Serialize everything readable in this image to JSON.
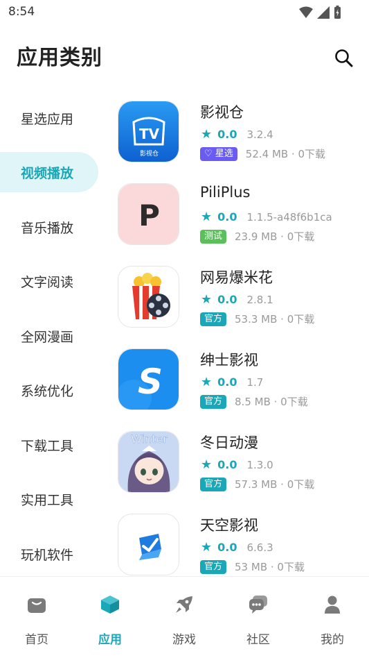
{
  "status_bar": {
    "time": "8:54"
  },
  "header": {
    "title": "应用类别"
  },
  "categories": [
    {
      "label": "星选应用",
      "active": false
    },
    {
      "label": "视频播放",
      "active": true
    },
    {
      "label": "音乐播放",
      "active": false
    },
    {
      "label": "文字阅读",
      "active": false
    },
    {
      "label": "全网漫画",
      "active": false
    },
    {
      "label": "系统优化",
      "active": false
    },
    {
      "label": "下载工具",
      "active": false
    },
    {
      "label": "实用工具",
      "active": false
    },
    {
      "label": "玩机软件",
      "active": false
    }
  ],
  "apps": [
    {
      "name": "影视仓",
      "star": "★",
      "rating": "0.0",
      "version": "3.2.4",
      "badge": "♡ 星选",
      "badge_type": "star",
      "size_downloads": "52.4 MB · 0下载",
      "icon_text": "TV",
      "icon_subtext": "影视仓"
    },
    {
      "name": "PiliPlus",
      "star": "★",
      "rating": "0.0",
      "version": "1.1.5-a48f6b1ca",
      "badge": "测试",
      "badge_type": "test",
      "size_downloads": "23.9 MB · 0下载",
      "icon_text": "P"
    },
    {
      "name": "网易爆米花",
      "star": "★",
      "rating": "0.0",
      "version": "2.8.1",
      "badge": "官方",
      "badge_type": "official",
      "size_downloads": "53.3 MB · 0下载"
    },
    {
      "name": "绅士影视",
      "star": "★",
      "rating": "0.0",
      "version": "1.7",
      "badge": "官方",
      "badge_type": "official",
      "size_downloads": "8.5 MB · 0下载",
      "icon_text": "S"
    },
    {
      "name": "冬日动漫",
      "star": "★",
      "rating": "0.0",
      "version": "1.3.0",
      "badge": "官方",
      "badge_type": "official",
      "size_downloads": "57.3 MB · 0下载",
      "icon_text": "Winter"
    },
    {
      "name": "天空影视",
      "star": "★",
      "rating": "0.0",
      "version": "6.6.3",
      "badge": "官方",
      "badge_type": "official",
      "size_downloads": "53 MB · 0下载"
    }
  ],
  "bottom_nav": [
    {
      "label": "首页",
      "icon": "bag-icon",
      "active": false
    },
    {
      "label": "应用",
      "icon": "cube-icon",
      "active": true
    },
    {
      "label": "游戏",
      "icon": "rocket-icon",
      "active": false
    },
    {
      "label": "社区",
      "icon": "chat-icon",
      "active": false
    },
    {
      "label": "我的",
      "icon": "user-icon",
      "active": false
    }
  ],
  "colors": {
    "accent": "#1aa7b7",
    "active_bg": "#dff5f7",
    "badge_star": "#6a5cf0",
    "badge_test": "#5bbf5b"
  }
}
